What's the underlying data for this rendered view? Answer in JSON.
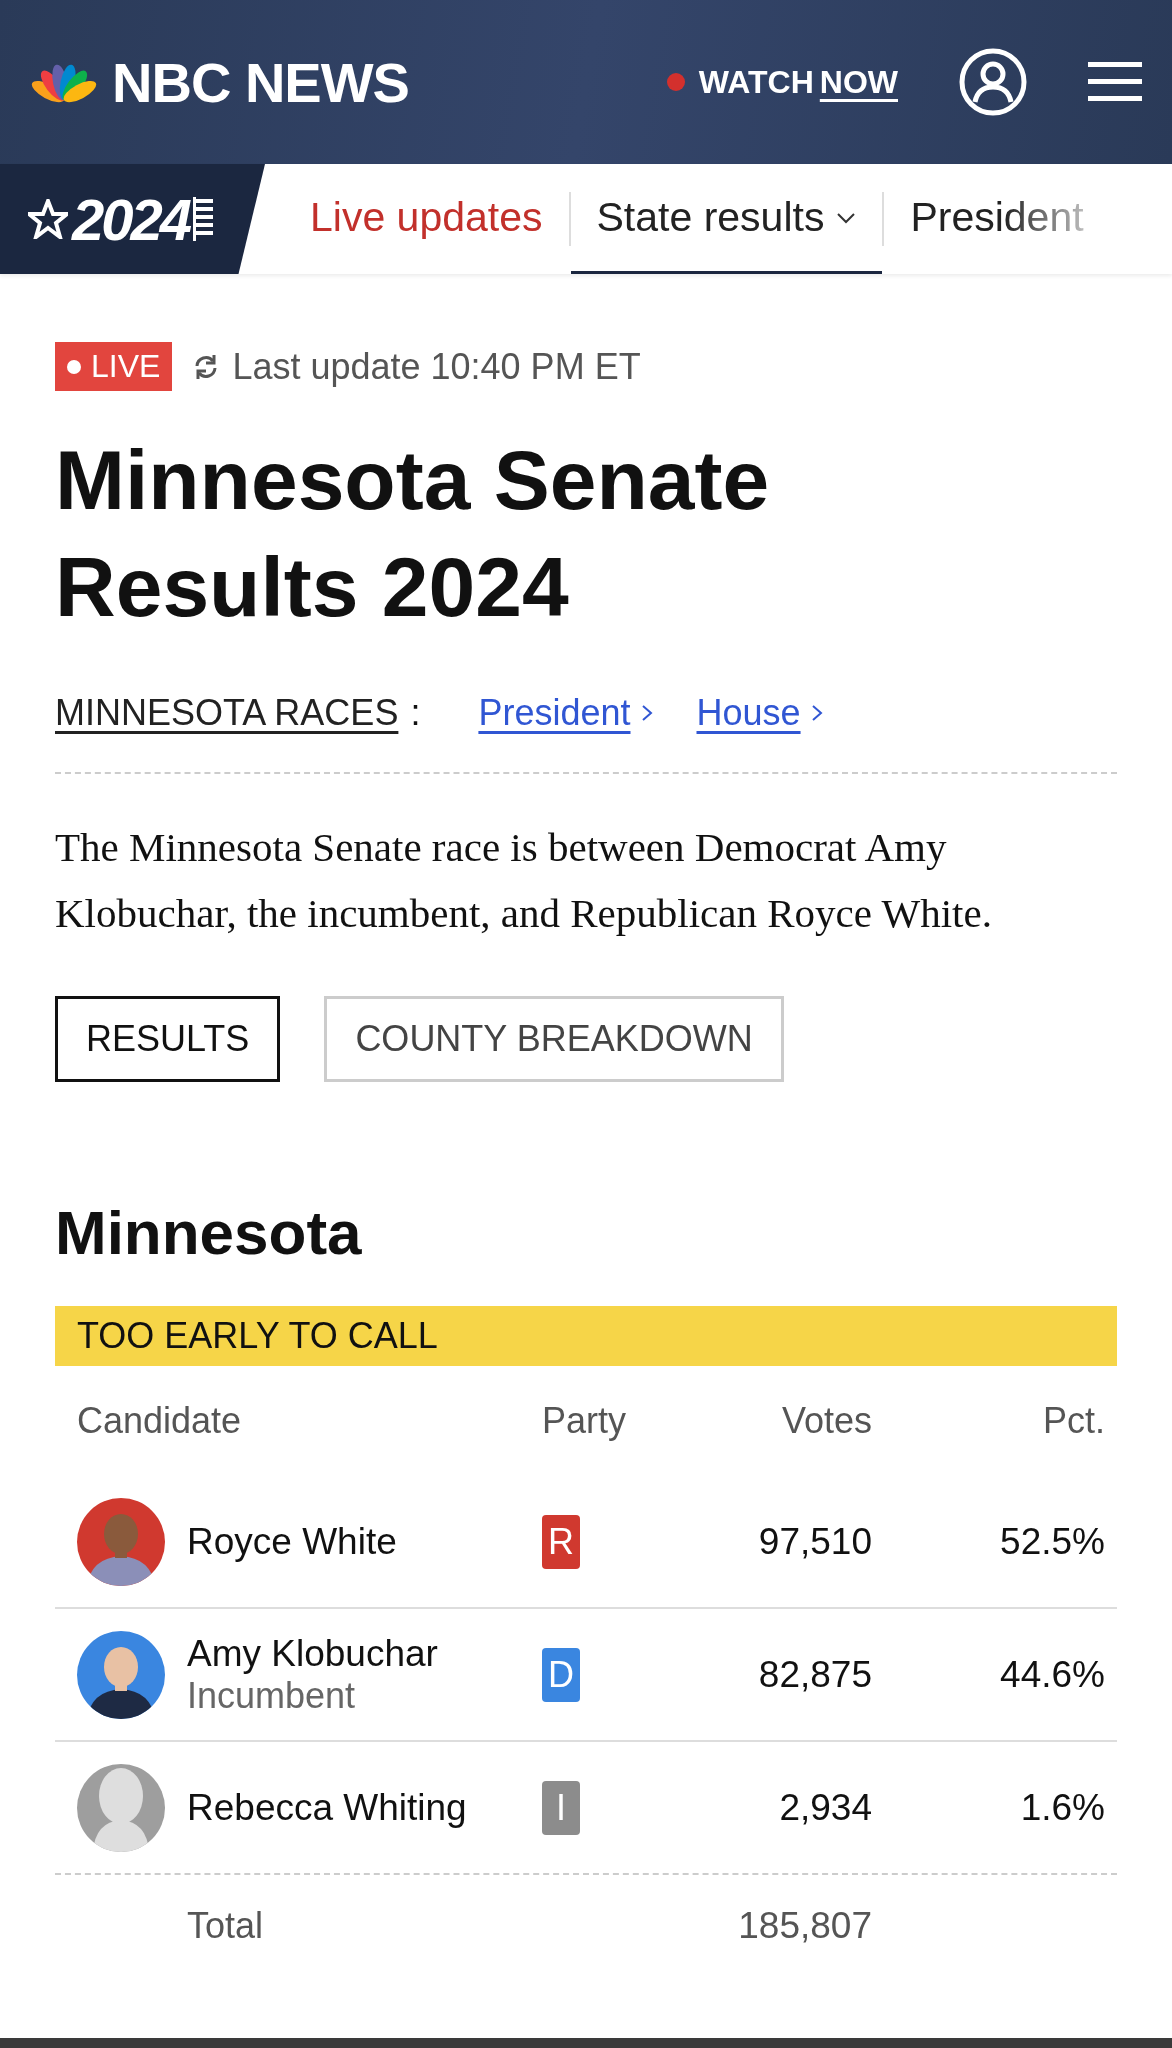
{
  "header": {
    "brand": "NBC NEWS",
    "watch_label": "WATCH",
    "watch_emphasis": "NOW"
  },
  "nav": {
    "badge": "2024",
    "tabs": [
      {
        "label": "Live updates",
        "kind": "live",
        "selected": false
      },
      {
        "label": "State results",
        "kind": "dropdown",
        "selected": true
      },
      {
        "label": "President",
        "kind": "faded",
        "selected": false
      }
    ]
  },
  "live_badge": "LIVE",
  "last_update": "Last update 10:40 PM ET",
  "title": "Minnesota Senate Results 2024",
  "races": {
    "label": "MINNESOTA RACES",
    "separator": ":",
    "links": [
      "President",
      "House"
    ]
  },
  "summary": "The Minnesota Senate race is between Democrat Amy Klobuchar, the incumbent, and Republican Royce White.",
  "view_tabs": [
    {
      "label": "RESULTS",
      "selected": true
    },
    {
      "label": "COUNTY BREAKDOWN",
      "selected": false
    }
  ],
  "results": {
    "region": "Minnesota",
    "status": "TOO EARLY TO CALL",
    "columns": [
      "Candidate",
      "Party",
      "Votes",
      "Pct."
    ],
    "rows": [
      {
        "name": "Royce White",
        "party": "R",
        "color": "#d0392f",
        "votes": "97,510",
        "pct": "52.5%"
      },
      {
        "name": "Amy Klobuchar",
        "note": "Incumbent",
        "party": "D",
        "color": "#3a86e0",
        "votes": "82,875",
        "pct": "44.6%"
      },
      {
        "name": "Rebecca Whiting",
        "party": "I",
        "color": "#8c8c8c",
        "avatar": {
          "kind": "silhouette"
        },
        "votes": "2,934",
        "pct": "1.6%"
      }
    ],
    "total_label": "Total",
    "total_votes": "185,807"
  }
}
